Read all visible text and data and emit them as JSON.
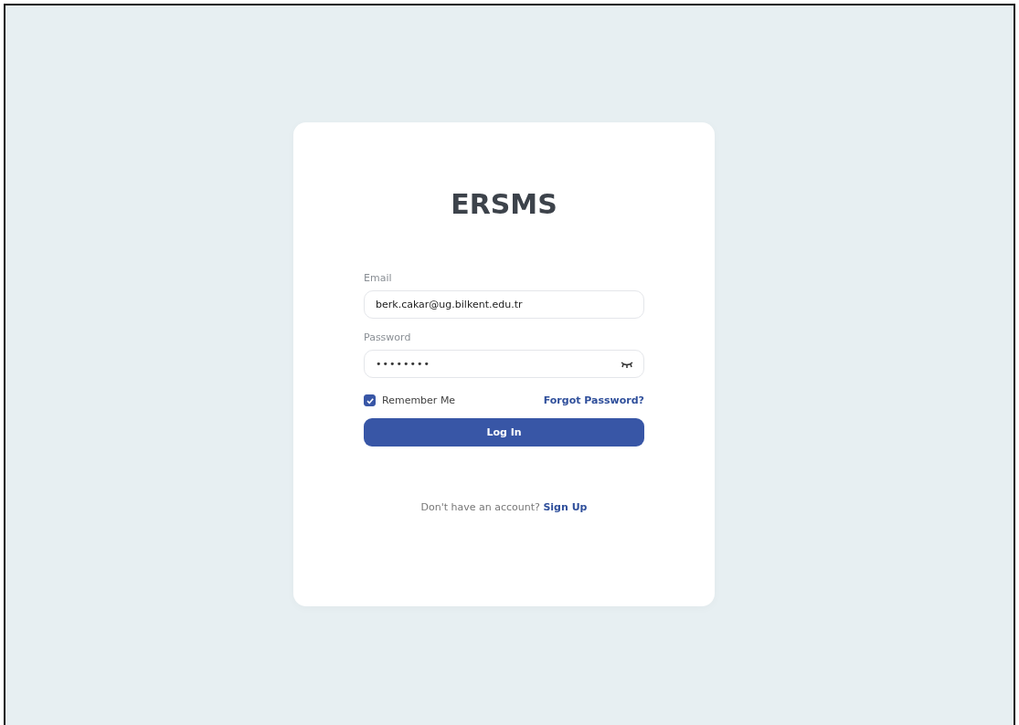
{
  "app": {
    "title": "ERSMS"
  },
  "form": {
    "email": {
      "label": "Email",
      "value": "berk.cakar@ug.bilkent.edu.tr"
    },
    "password": {
      "label": "Password",
      "value": "••••••••",
      "revealed": false
    },
    "remember": {
      "label": "Remember Me",
      "checked": true
    },
    "forgot_link": "Forgot Password?",
    "submit": "Log In",
    "signup_prompt": "Don't have an account?",
    "signup_link": "Sign Up"
  }
}
